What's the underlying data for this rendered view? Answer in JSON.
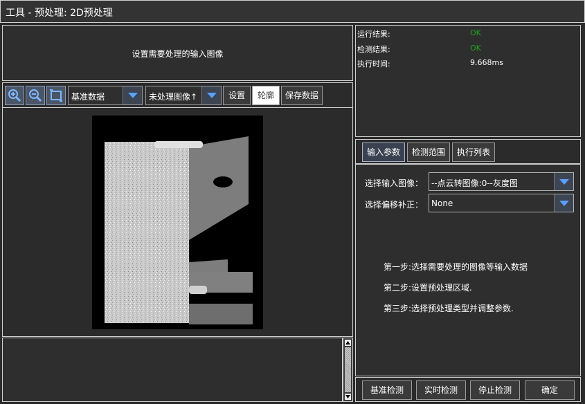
{
  "window": {
    "title": "工具 - 预处理: 2D预处理"
  },
  "prompt": {
    "text": "设置需要处理的输入图像"
  },
  "toolbar": {
    "zoom_in_icon": "zoom-in-icon",
    "zoom_out_icon": "zoom-out-icon",
    "fit_icon": "fit-to-window-icon",
    "data_source": "基准数据",
    "image_select": "未处理图像↑",
    "settings_label": "设置",
    "contour_label": "轮廓",
    "save_label": "保存数据"
  },
  "results": {
    "run_result_label": "运行结果:",
    "run_result_value": "OK",
    "detect_result_label": "检测结果:",
    "detect_result_value": "OK",
    "exec_time_label": "执行时间:",
    "exec_time_value": "9.668ms",
    "ok_color": "#1fa51f"
  },
  "tabs": [
    "输入参数",
    "检测范围",
    "执行列表"
  ],
  "params": {
    "input_image_label": "选择输入图像：",
    "input_image_value": "--点云转图像:0--灰度图",
    "offset_label": "选择偏移补正：",
    "offset_value": "None"
  },
  "steps": [
    "第一步:选择需要处理的图像等输入数据",
    "第二步:设置预处理区域.",
    "第三步:选择预处理类型并调整参数."
  ],
  "bottom": {
    "baseline_detect": "基准检测",
    "realtime_detect": "实时检测",
    "stop_detect": "停止检测",
    "confirm": "确定"
  }
}
